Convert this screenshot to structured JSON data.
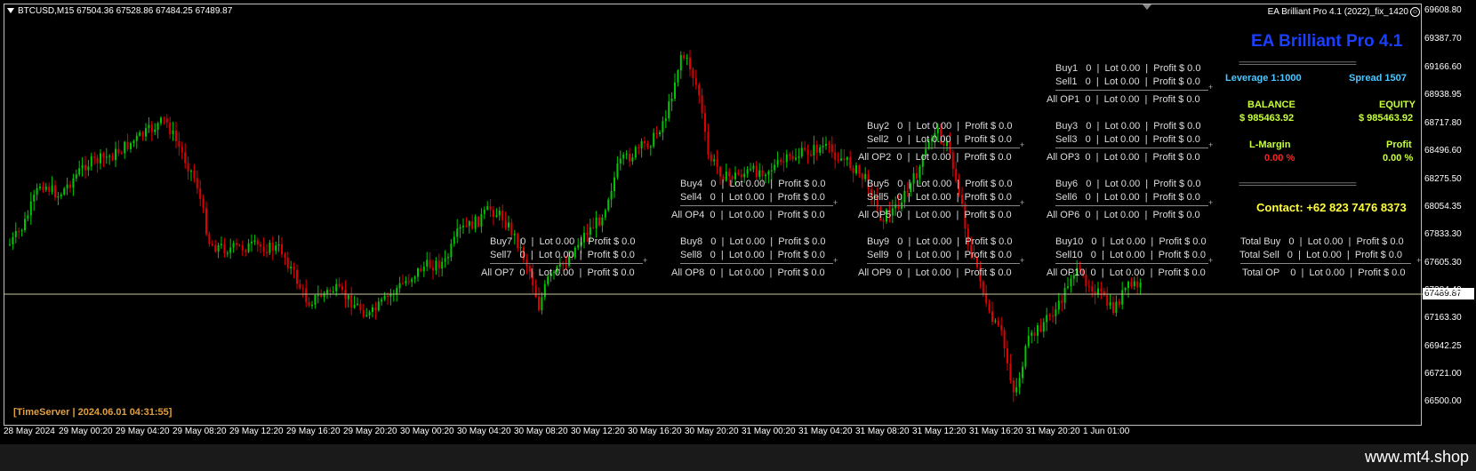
{
  "chart_header": {
    "symbol_line": "BTCUSD,M15  67504.36 67528.86 67484.25 67489.87",
    "ea_name": "EA Brilliant Pro 4.1 (2022)_fix_1420",
    "face_glyph": "☺"
  },
  "price_axis": {
    "ticks": [
      "69608.80",
      "69387.70",
      "69166.60",
      "68938.95",
      "68717.80",
      "68496.60",
      "68275.50",
      "68054.35",
      "67833.30",
      "67605.30",
      "67384.40",
      "67163.30",
      "66942.25",
      "66721.00",
      "66500.00"
    ],
    "current_price": "67489.87"
  },
  "time_axis": {
    "ticks": [
      "28 May 2024",
      "29 May 00:20",
      "29 May 04:20",
      "29 May 08:20",
      "29 May 12:20",
      "29 May 16:20",
      "29 May 20:20",
      "30 May 00:20",
      "30 May 04:20",
      "30 May 08:20",
      "30 May 12:20",
      "30 May 16:20",
      "30 May 20:20",
      "31 May 00:20",
      "31 May 04:20",
      "31 May 08:20",
      "31 May 12:20",
      "31 May 16:20",
      "31 May 20:20",
      "1 Jun 01:00"
    ]
  },
  "order_blocks": [
    {
      "buy": "Buy1   0  |  Lot 0.00  |  Profit $ 0.0",
      "sell": "Sell1   0  |  Lot 0.00  |  Profit $ 0.0",
      "all": "All OP1  0  |  Lot 0.00  |  Profit $ 0.0"
    },
    {
      "buy": "Buy2   0  |  Lot 0.00  |  Profit $ 0.0",
      "sell": "Sell2   0  |  Lot 0.00  |  Profit $ 0.0",
      "all": "All OP2  0  |  Lot 0.00  |  Profit $ 0.0"
    },
    {
      "buy": "Buy3   0  |  Lot 0.00  |  Profit $ 0.0",
      "sell": "Sell3   0  |  Lot 0.00  |  Profit $ 0.0",
      "all": "All OP3  0  |  Lot 0.00  |  Profit $ 0.0"
    },
    {
      "buy": "Buy4   0  |  Lot 0.00  |  Profit $ 0.0",
      "sell": "Sell4   0  |  Lot 0.00  |  Profit $ 0.0",
      "all": "All OP4  0  |  Lot 0.00  |  Profit $ 0.0"
    },
    {
      "buy": "Buy5   0  |  Lot 0.00  |  Profit $ 0.0",
      "sell": "Sell5   0  |  Lot 0.00  |  Profit $ 0.0",
      "all": "All OP5  0  |  Lot 0.00  |  Profit $ 0.0"
    },
    {
      "buy": "Buy6   0  |  Lot 0.00  |  Profit $ 0.0",
      "sell": "Sell6   0  |  Lot 0.00  |  Profit $ 0.0",
      "all": "All OP6  0  |  Lot 0.00  |  Profit $ 0.0"
    },
    {
      "buy": "Buy7   0  |  Lot 0.00  |  Profit $ 0.0",
      "sell": "Sell7   0  |  Lot 0.00  |  Profit $ 0.0",
      "all": "All OP7  0  |  Lot 0.00  |  Profit $ 0.0"
    },
    {
      "buy": "Buy8   0  |  Lot 0.00  |  Profit $ 0.0",
      "sell": "Sell8   0  |  Lot 0.00  |  Profit $ 0.0",
      "all": "All OP8  0  |  Lot 0.00  |  Profit $ 0.0"
    },
    {
      "buy": "Buy9   0  |  Lot 0.00  |  Profit $ 0.0",
      "sell": "Sell9   0  |  Lot 0.00  |  Profit $ 0.0",
      "all": "All OP9  0  |  Lot 0.00  |  Profit $ 0.0"
    },
    {
      "buy": "Buy10   0  |  Lot 0.00  |  Profit $ 0.0",
      "sell": "Sell10   0  |  Lot 0.00  |  Profit $ 0.0",
      "all": "All OP10  0  |  Lot 0.00  |  Profit $ 0.0"
    }
  ],
  "totals": {
    "buy": "Total Buy   0  |  Lot 0.00  |  Profit $ 0.0",
    "sell": "Total Sell   0  |  Lot 0.00  |  Profit $ 0.0",
    "op": "Total OP    0  |  Lot 0.00  |  Profit $ 0.0"
  },
  "panel": {
    "title": "EA Brilliant Pro 4.1",
    "leverage": "Leverage  1:1000",
    "spread": "Spread   1507",
    "balance_label": "BALANCE",
    "balance_value": "$ 985463.92",
    "equity_label": "EQUITY",
    "equity_value": "$ 985463.92",
    "lmargin_label": "L-Margin",
    "lmargin_value": "0.00 %",
    "profit_label": "Profit",
    "profit_value": "0.00 %",
    "contact": "Contact: +62 823 7476 8373",
    "separator": "==============================="
  },
  "time_server": "[TimeServer | 2024.06.01 04:31:55]",
  "watermark": "www.mt4.shop",
  "colors": {
    "bull": "#00c800",
    "bear": "#e00000",
    "price_line": "#c8c8a0"
  }
}
